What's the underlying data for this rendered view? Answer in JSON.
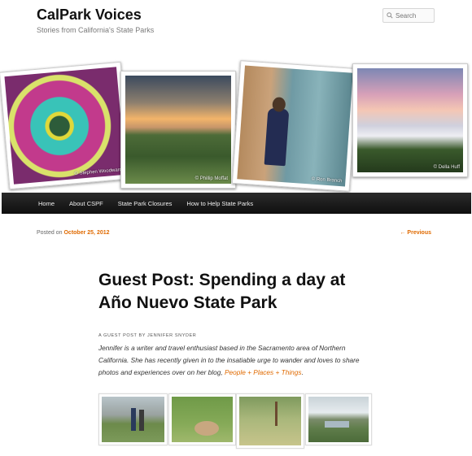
{
  "site": {
    "title": "CalPark Voices",
    "tagline": "Stories from California's State Parks"
  },
  "search": {
    "placeholder": "Search"
  },
  "header_photos": [
    {
      "credit": "© Stephen Woodward",
      "icon": "sea-anemone-photo"
    },
    {
      "credit": "© Phillip Moffat",
      "icon": "tidepool-sunset-photo"
    },
    {
      "credit": "© Ron Branch",
      "icon": "child-at-door-photo"
    },
    {
      "credit": "© Della Huff",
      "icon": "foggy-hills-photo"
    }
  ],
  "nav": {
    "items": [
      "Home",
      "About CSPF",
      "State Park Closures",
      "How to Help State Parks"
    ]
  },
  "post": {
    "posted_on_label": "Posted on",
    "date": "October 25, 2012",
    "previous_label": "← Previous",
    "title_line1": "Guest Post: Spending a day at",
    "title_line2": "Año Nuevo State Park",
    "byline": "A GUEST POST BY JENNIFER SNYDER",
    "intro_text": "Jennifer is a writer and travel enthusiast based in the Sacramento area of Northern California. She has recently given in to the insatiable urge to wander and loves to share photos and experiences over on her blog,",
    "blog_link": "People + Places + Things",
    "intro_end": "."
  },
  "gallery": [
    {
      "icon": "couple-at-beach-photo"
    },
    {
      "icon": "elephant-seal-photo"
    },
    {
      "icon": "seal-in-grass-photo"
    },
    {
      "icon": "coastline-photo"
    }
  ],
  "colors": {
    "accent": "#e06a00",
    "nav_bg": "#1a1a1a"
  }
}
